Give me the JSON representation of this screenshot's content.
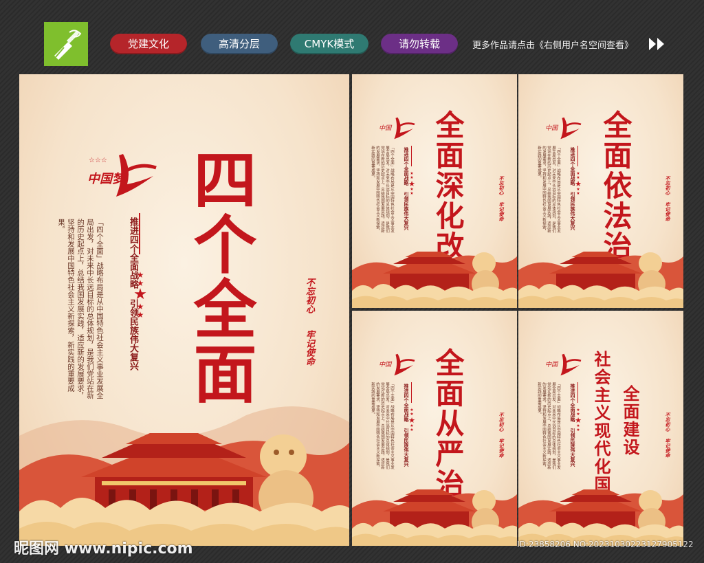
{
  "header": {
    "pills": [
      "党建文化",
      "高清分层",
      "CMYK模式",
      "请勿转载"
    ],
    "more_text": "更多作品请点击《右侧用户名空间查看》",
    "arrow_icon": "double-chevron-right-icon",
    "logo_icon": "pen-nib-logo-icon"
  },
  "colors": {
    "brand_red": "#c3161c",
    "poster_bg": "#f6e3cb",
    "pill_red": "#b5252a",
    "pill_blue": "#3f5e7d",
    "pill_teal": "#2f7a72",
    "pill_purple": "#6c2f86"
  },
  "posters": {
    "main": {
      "title": "四个全面",
      "logo": "中国梦",
      "subtitle": "推进四个全面战略 引领民族伟大复兴",
      "body": "「四个全面」战略布局是从中国特色社会主义事业发展全局出发，对未来中长远目标的总体规划，是我们党站在新的历史起点上，总结我国发展实践，适应新的发展要求，坚持和发展中国特色社会主义新探索，新实践的重要成果。",
      "seal": [
        "不忘初心",
        "牢记使命"
      ]
    },
    "p1": {
      "title": "全面深化改革"
    },
    "p2": {
      "title": "全面依法治国"
    },
    "p3": {
      "title": "全面从严治党"
    },
    "p4": {
      "title_a": "社会主义现代化国家",
      "title_b": "全面建设"
    }
  },
  "watermark": {
    "left": "昵图网 www.nipic.com",
    "right": "ID:23858206 NO:20231030223127905122"
  }
}
